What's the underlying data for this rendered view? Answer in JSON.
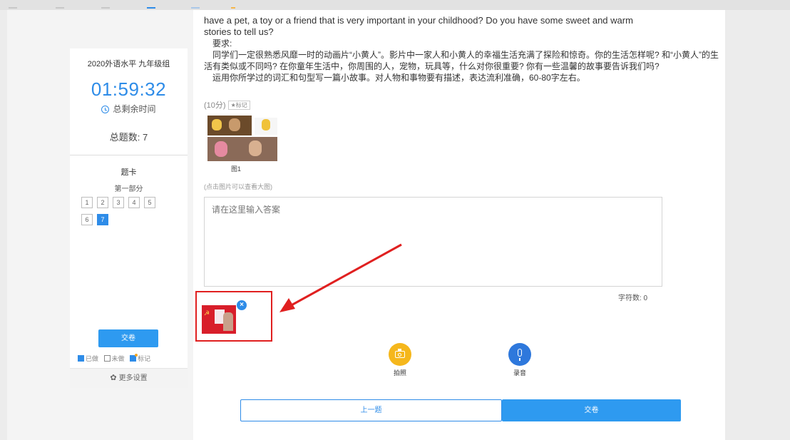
{
  "sidebar": {
    "exam_title": "2020外语水平 九年级组",
    "timer": "01:59:32",
    "remaining_label": "总剩余时间",
    "total_questions": "总题数: 7",
    "card_title": "题卡",
    "part_label": "第一部分",
    "question_numbers": [
      "1",
      "2",
      "3",
      "4",
      "5",
      "6",
      "7"
    ],
    "current_question": "7",
    "submit_label": "交卷",
    "legend": {
      "done": "已做",
      "undone": "未做",
      "marked": "标记"
    },
    "more_settings": "更多设置"
  },
  "question": {
    "english_line1": "have a pet, a toy or a friend that is very important in your childhood? Do you have some sweet and warm",
    "english_line2": "stories to tell us?",
    "requirement_heading": "要求:",
    "requirement_p1": "同学们一定很熟悉风靡一时的动画片“小黄人”。影片中一家人和小黄人的幸福生活充满了探险和惊奇。你的生活怎样呢? 和“小黄人”的生活有类似或不同吗? 在你童年生活中，你周围的人，宠物，玩具等，什么对你很重要? 你有一些温馨的故事要告诉我们吗?",
    "requirement_p2": "运用你所学过的词汇和句型写一篇小故事。对人物和事物要有描述，表达流利准确，60-80字左右。",
    "score": "(10分)",
    "mark_label": "★标记",
    "image_caption": "图1",
    "image_hint": "(点击图片可以查看大图)"
  },
  "answer": {
    "placeholder": "请在这里输入答案",
    "char_count": "字符数: 0"
  },
  "tools": {
    "photo_label": "拍照",
    "record_label": "录音"
  },
  "nav": {
    "prev_label": "上一题",
    "submit_label": "交卷"
  },
  "colors": {
    "accent": "#2e8ce8",
    "highlight_frame": "#e02020",
    "photo_button": "#f5b71c",
    "record_button": "#2e78dc"
  }
}
